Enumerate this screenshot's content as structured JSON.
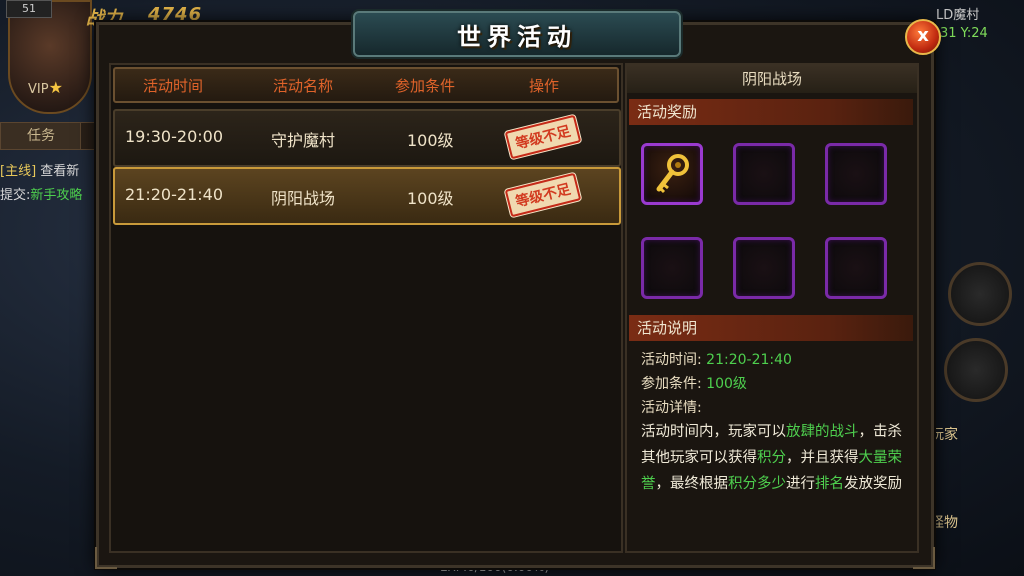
{
  "hud": {
    "level": "51",
    "power_label": "战力",
    "power_value": "4746",
    "vip": "VIP",
    "task_tab": "任务",
    "quest_line1_tag": "[主线]",
    "quest_line1_text": "查看新",
    "quest_line2_label": "提交:",
    "quest_line2_text": "新手攻略",
    "map_name": "LD魔村",
    "coord": "31 Y:24",
    "side_text1": "玩家",
    "side_text2": "怪物",
    "exp": "EXP:0/100(0.00%)"
  },
  "dialog": {
    "title": "世界活动",
    "close_label": "x"
  },
  "list": {
    "headers": [
      "活动时间",
      "活动名称",
      "参加条件",
      "操作"
    ],
    "rows": [
      {
        "time": "19:30-20:00",
        "name": "守护魔村",
        "cond": "100级",
        "action": "等级不足",
        "selected": false
      },
      {
        "time": "21:20-21:40",
        "name": "阴阳战场",
        "cond": "100级",
        "action": "等级不足",
        "selected": true
      }
    ]
  },
  "detail": {
    "title": "阴阳战场",
    "reward_header": "活动奖励",
    "reward_slots": [
      "key-icon",
      "",
      "",
      "",
      "",
      ""
    ],
    "desc_header": "活动说明",
    "time_label": "活动时间:",
    "time_value": "21:20-21:40",
    "cond_label": "参加条件:",
    "cond_value": "100级",
    "detail_label": "活动详情:",
    "desc": [
      {
        "t": "活动时间内，玩家可以",
        "g": false
      },
      {
        "t": "放肆的战斗",
        "g": true
      },
      {
        "t": "，击杀其他玩家可以获得",
        "g": false
      },
      {
        "t": "积分",
        "g": true
      },
      {
        "t": "，并且获得",
        "g": false
      },
      {
        "t": "大量荣誉",
        "g": true
      },
      {
        "t": "，最终根据",
        "g": false
      },
      {
        "t": "积分多少",
        "g": true
      },
      {
        "t": "进行",
        "g": false
      },
      {
        "t": "排名",
        "g": true
      },
      {
        "t": "发放奖励",
        "g": false
      }
    ]
  },
  "colors": {
    "header_text": "#e0632a",
    "green_text": "#4ecf4e",
    "section_bar": "#7a2c14",
    "slot_border": "#7a2aa8"
  }
}
